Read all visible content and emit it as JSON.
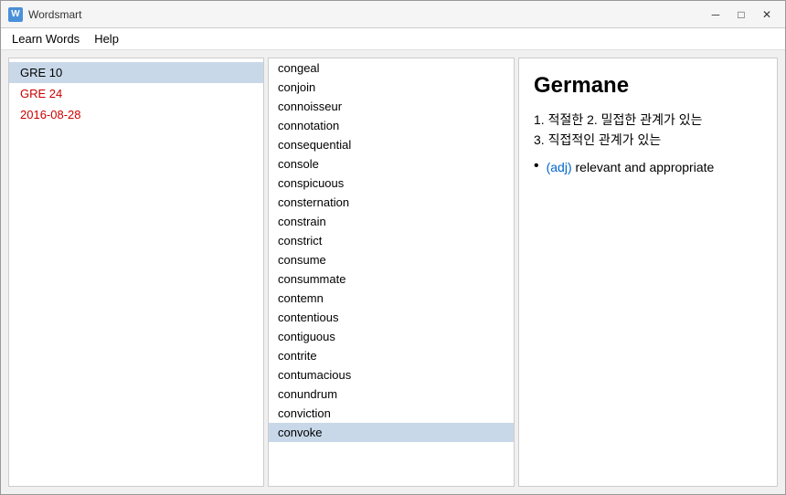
{
  "window": {
    "title": "Wordsmart",
    "icon_label": "W"
  },
  "titlebar": {
    "minimize_label": "─",
    "maximize_label": "□",
    "close_label": "✕"
  },
  "menubar": {
    "items": [
      {
        "label": "Learn Words",
        "id": "learn-words"
      },
      {
        "label": "Help",
        "id": "help"
      }
    ]
  },
  "left_panel": {
    "items": [
      {
        "label": "GRE 10",
        "selected": true,
        "color": "selected"
      },
      {
        "label": "GRE 24",
        "color": "red"
      },
      {
        "label": "2016-08-28",
        "color": "red"
      }
    ]
  },
  "word_list": {
    "words": [
      "congeal",
      "conjoin",
      "connoisseur",
      "connotation",
      "consequential",
      "console",
      "conspicuous",
      "consternation",
      "constrain",
      "constrict",
      "consume",
      "consummate",
      "contemn",
      "contentious",
      "contiguous",
      "contrite",
      "contumacious",
      "conundrum",
      "conviction",
      "convoke"
    ],
    "selected_index": 19
  },
  "definition": {
    "title": "Germane",
    "korean_lines": [
      "1. 적절한 2. 밀접한 관계가 있는",
      "3. 직접적인 관계가 있는"
    ],
    "bullet": {
      "pos": "(adj)",
      "text": " relevant and appropriate"
    }
  },
  "colors": {
    "accent_red": "#cc0000",
    "accent_blue": "#0066cc",
    "selected_bg": "#c8d8e8"
  }
}
